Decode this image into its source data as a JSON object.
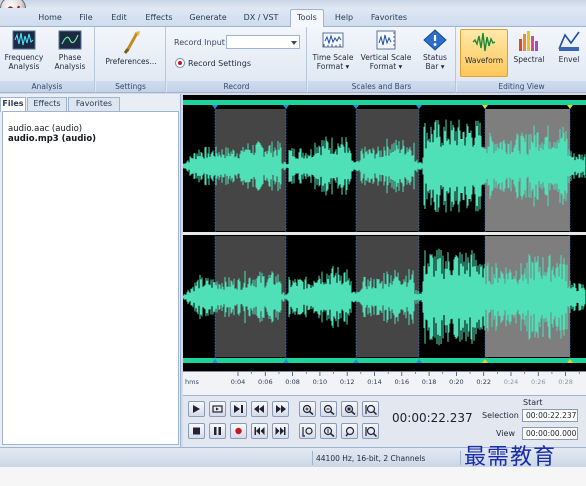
{
  "ribbon_tabs": [
    "Home",
    "File",
    "Edit",
    "Effects",
    "Generate",
    "DX / VST",
    "Tools",
    "Help",
    "Favorites"
  ],
  "active_tab": "Tools",
  "groups": {
    "analysis": {
      "label": "Analysis",
      "buttons": [
        {
          "label1": "Frequency",
          "label2": "Analysis",
          "icon": "frequency-analysis-icon"
        },
        {
          "label1": "Phase",
          "label2": "Analysis",
          "icon": "phase-analysis-icon"
        }
      ]
    },
    "settings": {
      "label": "Settings",
      "buttons": [
        {
          "label1": "Preferences...",
          "icon": "preferences-icon"
        }
      ]
    },
    "record": {
      "label": "Record",
      "input_label": "Record Input",
      "input_value": "",
      "settings_label": "Record Settings"
    },
    "scales": {
      "label": "Scales and Bars",
      "buttons": [
        {
          "label1": "Time Scale",
          "label2": "Format ▾",
          "icon": "time-scale-icon"
        },
        {
          "label1": "Vertical Scale",
          "label2": "Format ▾",
          "icon": "vertical-scale-icon"
        },
        {
          "label1": "Status",
          "label2": "Bar ▾",
          "icon": "status-bar-icon"
        }
      ]
    },
    "editing_view": {
      "label": "Editing View",
      "buttons": [
        {
          "label1": "Waveform",
          "icon": "waveform-icon",
          "selected": true
        },
        {
          "label1": "Spectral",
          "icon": "spectral-icon"
        },
        {
          "label1": "Envel",
          "icon": "envelope-icon"
        }
      ]
    }
  },
  "panel_tabs": [
    "Files",
    "Effects",
    "Favorites"
  ],
  "active_panel_tab": "Files",
  "files": [
    {
      "name": "audio.aac (audio)",
      "selected": false
    },
    {
      "name": "audio.mp3 (audio)",
      "selected": true
    }
  ],
  "timeline": {
    "unit": "hms",
    "ticks": [
      "0:04",
      "0:06",
      "0:08",
      "0:10",
      "0:12",
      "0:14",
      "0:16",
      "0:18",
      "0:20",
      "0:22",
      "0:24",
      "0:26",
      "0:28"
    ]
  },
  "transport": {
    "current_time": "00:00:22.237",
    "start_label": "Start",
    "selection_label": "Selection",
    "selection_start": "00:00:22.237",
    "view_label": "View",
    "view_start": "00:00:00.000"
  },
  "status": {
    "format": "44100 Hz, 16-bit, 2 Channels"
  },
  "watermark": "最需教育",
  "colors": {
    "wave": "#4fe0b8",
    "selection": "#7c7c7c",
    "marker_bar": "#1fd49c"
  }
}
